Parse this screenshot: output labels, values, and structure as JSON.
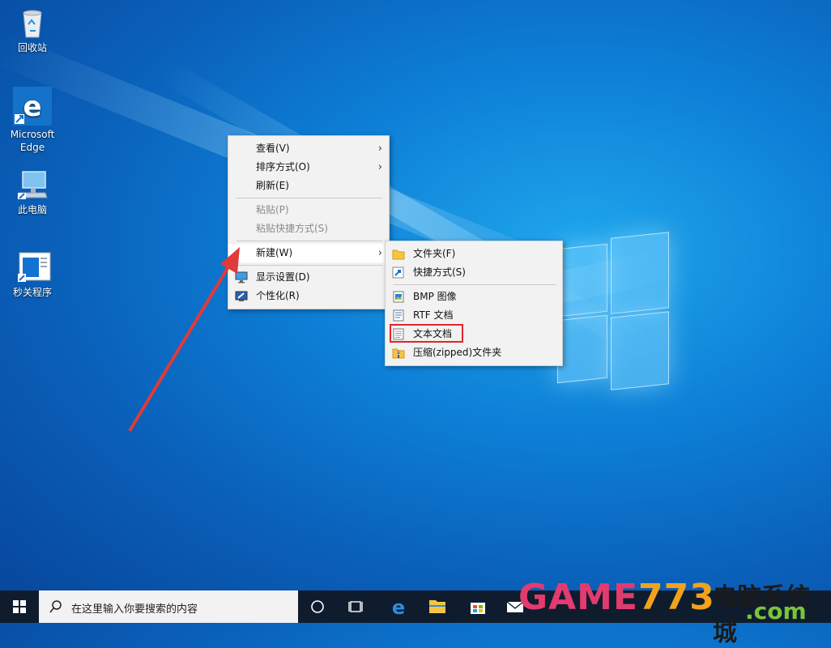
{
  "desktop": {
    "icons": [
      {
        "label": "回收站"
      },
      {
        "label": "Microsoft Edge"
      },
      {
        "label": "此电脑"
      },
      {
        "label": "秒关程序"
      }
    ]
  },
  "context_menu": {
    "items": [
      {
        "label": "查看(V)"
      },
      {
        "label": "排序方式(O)"
      },
      {
        "label": "刷新(E)"
      },
      {
        "label": "粘贴(P)"
      },
      {
        "label": "粘贴快捷方式(S)"
      },
      {
        "label": "新建(W)"
      },
      {
        "label": "显示设置(D)"
      },
      {
        "label": "个性化(R)"
      }
    ]
  },
  "submenu_new": {
    "items": [
      {
        "label": "文件夹(F)"
      },
      {
        "label": "快捷方式(S)"
      },
      {
        "label": "BMP 图像"
      },
      {
        "label": "RTF 文档"
      },
      {
        "label": "文本文档"
      },
      {
        "label": "压缩(zipped)文件夹"
      }
    ]
  },
  "taskbar": {
    "search_placeholder": "在这里输入你要搜索的内容"
  },
  "watermark": {
    "part1": "GAME",
    "part2": "773",
    "part3": ".com",
    "part4": "电脑系统城"
  },
  "colors": {
    "highlight_border": "#e0262a",
    "arrow": "#e03a3a"
  }
}
